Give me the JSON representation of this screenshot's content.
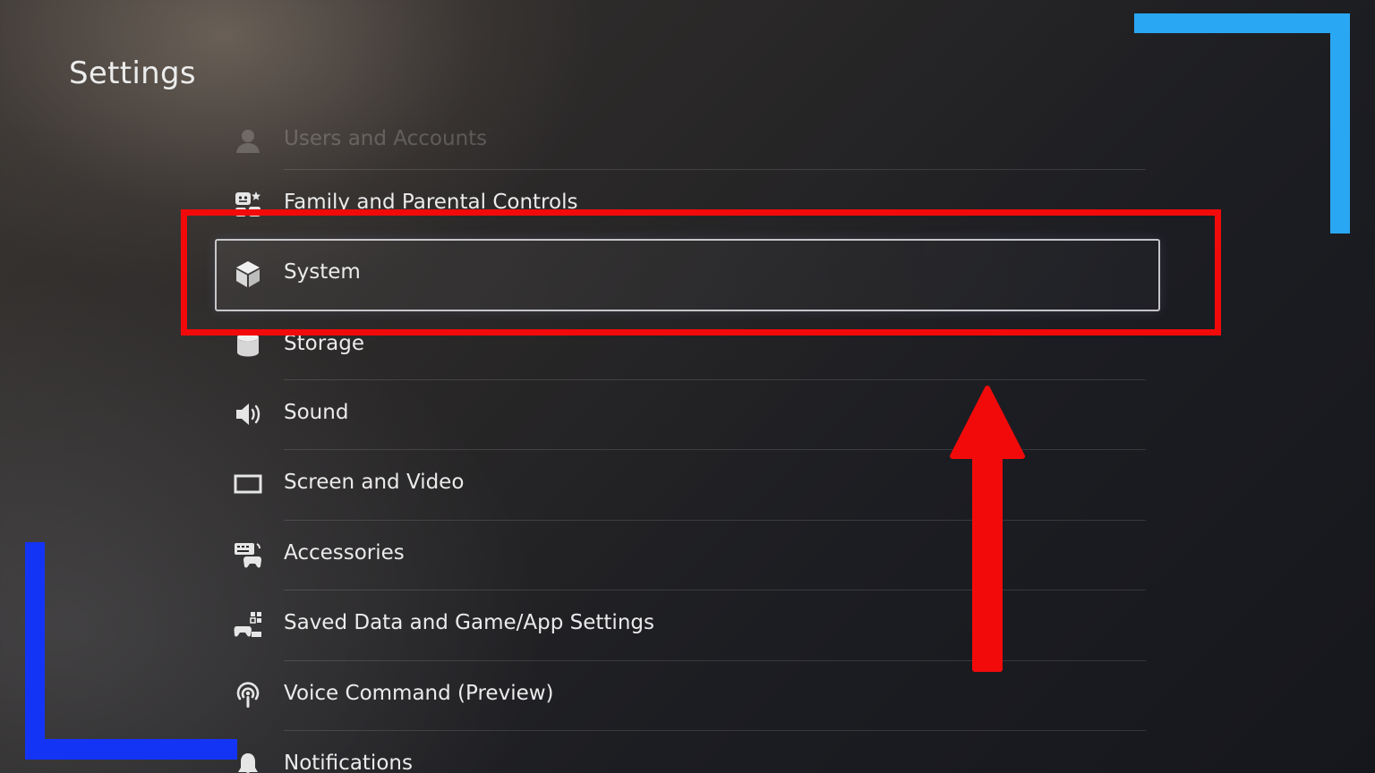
{
  "header": {
    "title": "Settings"
  },
  "menu": {
    "items": [
      {
        "label": "Users and Accounts",
        "icon": "users-icon"
      },
      {
        "label": "Family and Parental Controls",
        "icon": "family-icon"
      },
      {
        "label": "System",
        "icon": "cube-icon",
        "selected": true
      },
      {
        "label": "Storage",
        "icon": "storage-icon"
      },
      {
        "label": "Sound",
        "icon": "speaker-icon"
      },
      {
        "label": "Screen and Video",
        "icon": "screen-icon"
      },
      {
        "label": "Accessories",
        "icon": "accessories-icon"
      },
      {
        "label": "Saved Data and Game/App Settings",
        "icon": "saved-data-icon"
      },
      {
        "label": "Voice Command (Preview)",
        "icon": "voice-command-icon"
      },
      {
        "label": "Notifications",
        "icon": "bell-icon"
      }
    ]
  },
  "annotations": {
    "highlight_color": "#f20a0a",
    "arrow_color": "#f20a0a",
    "corner_top_right_color": "#2aa7f3",
    "corner_bottom_left_color": "#1434f5"
  }
}
